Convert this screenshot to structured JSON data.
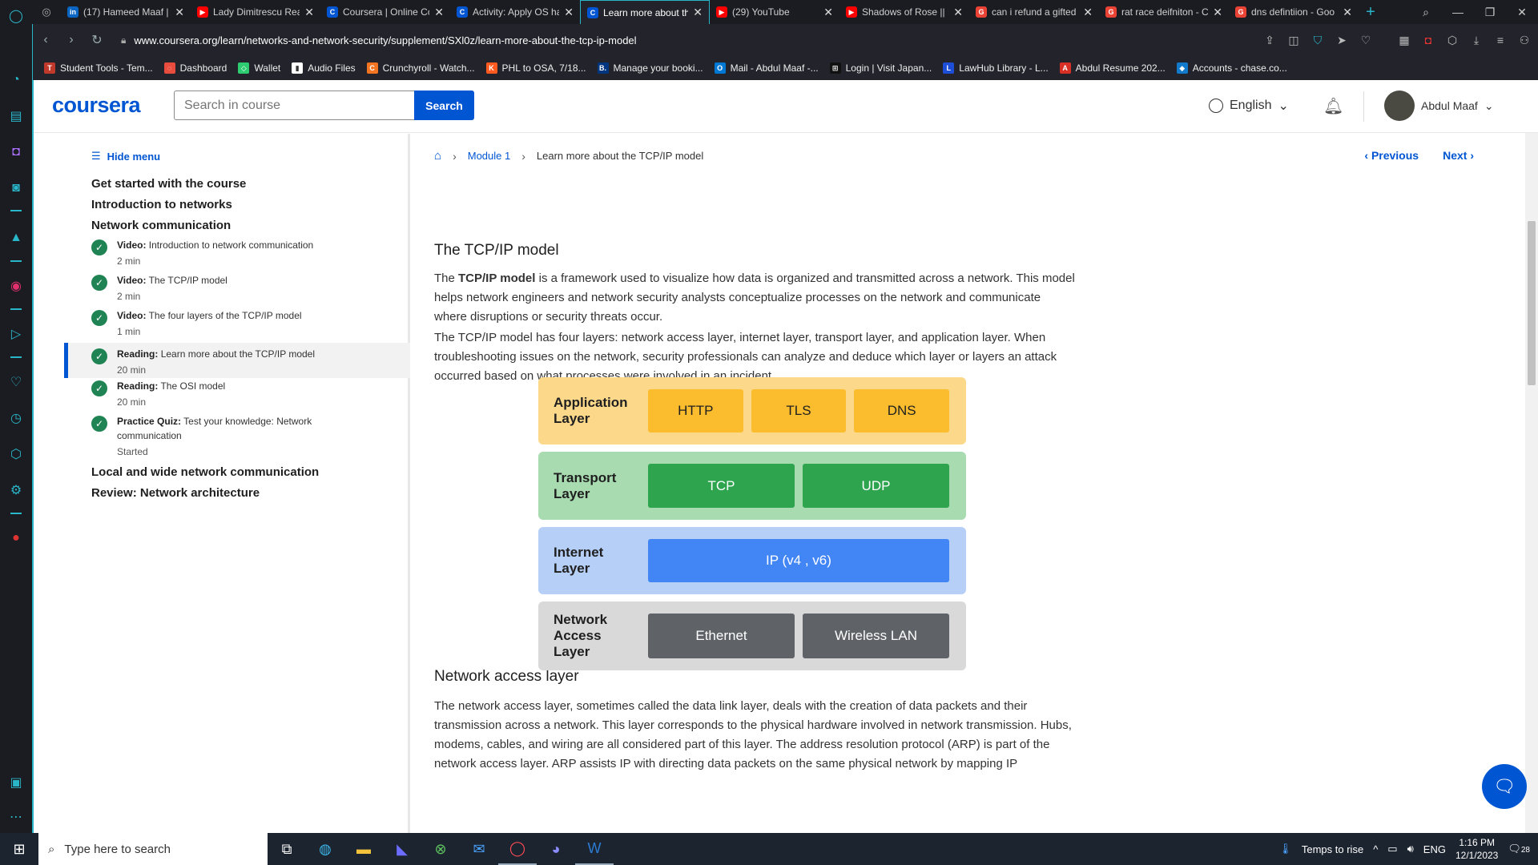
{
  "browser": {
    "tabs": [
      {
        "title": "(17) Hameed Maaf |",
        "favicon": "in",
        "color": "#0a66c2",
        "active": false
      },
      {
        "title": "Lady Dimitrescu Rea",
        "favicon": "▶",
        "color": "#ff0000",
        "active": false
      },
      {
        "title": "Coursera | Online Co",
        "favicon": "C",
        "color": "#0056d2",
        "active": false
      },
      {
        "title": "Activity: Apply OS ha",
        "favicon": "C",
        "color": "#0056d2",
        "active": false
      },
      {
        "title": "Learn more about th",
        "favicon": "C",
        "color": "#0056d2",
        "active": true
      },
      {
        "title": "(29) YouTube",
        "favicon": "▶",
        "color": "#ff0000",
        "active": false
      },
      {
        "title": "Shadows of Rose || R",
        "favicon": "▶",
        "color": "#ff0000",
        "active": false
      },
      {
        "title": "can i refund a gifted",
        "favicon": "G",
        "color": "#ea4335",
        "active": false
      },
      {
        "title": "rat race deifniton - C",
        "favicon": "G",
        "color": "#ea4335",
        "active": false
      },
      {
        "title": "dns defintiion - Goo",
        "favicon": "G",
        "color": "#ea4335",
        "active": false
      }
    ],
    "url": "www.coursera.org/learn/networks-and-network-security/supplement/SXl0z/learn-more-about-the-tcp-ip-model",
    "bookmarks": [
      {
        "label": "Student Tools - Tem...",
        "color": "#c0392b",
        "icon": "T"
      },
      {
        "label": "Dashboard",
        "color": "#e74c3c",
        "icon": "◌"
      },
      {
        "label": "Wallet",
        "color": "#2ecc71",
        "icon": "◇"
      },
      {
        "label": "Audio Files",
        "color": "#ffffff",
        "icon": "▮"
      },
      {
        "label": "Crunchyroll - Watch...",
        "color": "#f47521",
        "icon": "C"
      },
      {
        "label": "PHL to OSA, 7/18...",
        "color": "#ff5a1f",
        "icon": "K"
      },
      {
        "label": "Manage your booki...",
        "color": "#003580",
        "icon": "B."
      },
      {
        "label": "Mail - Abdul Maaf -...",
        "color": "#0078d4",
        "icon": "O"
      },
      {
        "label": "Login | Visit Japan...",
        "color": "#111111",
        "icon": "⊞"
      },
      {
        "label": "LawHub Library - L...",
        "color": "#1d4ed8",
        "icon": "L"
      },
      {
        "label": "Abdul Resume 202...",
        "color": "#d93025",
        "icon": "A"
      },
      {
        "label": "Accounts - chase.co...",
        "color": "#117aca",
        "icon": "◆"
      }
    ]
  },
  "header": {
    "logo": "coursera",
    "search_placeholder": "Search in course",
    "search_button": "Search",
    "language": "English",
    "user_name": "Abdul Maaf"
  },
  "menu": {
    "hide_label": "Hide menu",
    "sections_top": [
      "Get started with the course",
      "Introduction to networks",
      "Network communication"
    ],
    "items": [
      {
        "kind": "Video:",
        "title": "Introduction to network communication",
        "meta": "2 min"
      },
      {
        "kind": "Video:",
        "title": "The TCP/IP model",
        "meta": "2 min"
      },
      {
        "kind": "Video:",
        "title": "The four layers of the TCP/IP model",
        "meta": "1 min"
      },
      {
        "kind": "Reading:",
        "title": "Learn more about the TCP/IP model",
        "meta": "20 min"
      },
      {
        "kind": "Reading:",
        "title": "The OSI model",
        "meta": "20 min"
      },
      {
        "kind": "Practice Quiz:",
        "title": "Test your knowledge: Network communication",
        "meta": "Started"
      }
    ],
    "sections_bottom": [
      "Local and wide network communication",
      "Review: Network architecture"
    ]
  },
  "breadcrumb": {
    "module": "Module 1",
    "current": "Learn more about the TCP/IP model"
  },
  "nav": {
    "previous": "Previous",
    "next": "Next"
  },
  "article": {
    "h_tcpip": "The TCP/IP model",
    "p1_pre": "The ",
    "p1_bold": "TCP/IP model",
    "p1_post": " is a framework used to visualize how data is organized and transmitted across a network. This model helps network engineers and network security analysts conceptualize processes on the network and communicate where disruptions or security threats occur.",
    "p2": "The TCP/IP model has four layers: network access layer, internet layer, transport layer, and application layer. When troubleshooting issues on the network, security professionals can analyze and deduce which layer or layers an attack occurred based on what processes were involved in an incident.",
    "h_nal": "Network access layer",
    "p3": "The network access layer, sometimes called the data link layer, deals with the creation of data packets and their transmission across a network. This layer corresponds to the physical hardware involved in network transmission. Hubs, modems, cables, and wiring are all considered part of this layer. The address resolution protocol (ARP) is part of the network access layer. ARP assists IP with directing data packets on the same physical network by mapping IP"
  },
  "diagram": {
    "layers": [
      {
        "name_lines": [
          "Application",
          "Layer"
        ],
        "bg": "#fcd88b",
        "protocols": [
          "HTTP",
          "TLS",
          "DNS"
        ],
        "proto_bg": "#fbbc2e",
        "proto_fg": "#1f1f1f"
      },
      {
        "name_lines": [
          "Transport",
          "Layer"
        ],
        "bg": "#a8dbb0",
        "protocols": [
          "TCP",
          "UDP"
        ],
        "proto_bg": "#2ea44f",
        "proto_fg": "#ffffff"
      },
      {
        "name_lines": [
          "Internet",
          "Layer"
        ],
        "bg": "#b6cff7",
        "protocols": [
          "IP (v4 , v6)"
        ],
        "proto_bg": "#4285f4",
        "proto_fg": "#ffffff"
      },
      {
        "name_lines": [
          "Network",
          "Access",
          "Layer"
        ],
        "bg": "#d9d9d9",
        "protocols": [
          "Ethernet",
          "Wireless LAN"
        ],
        "proto_bg": "#5f6368",
        "proto_fg": "#ffffff"
      }
    ]
  },
  "taskbar": {
    "search_placeholder": "Type here to search",
    "weather": "Temps to rise",
    "lang": "ENG",
    "time": "1:16 PM",
    "date": "12/1/2023",
    "notifications": "28"
  },
  "colors": {
    "accent": "#0056d2",
    "opera_accent": "#2ab6c9",
    "complete_green": "#1f8354"
  }
}
